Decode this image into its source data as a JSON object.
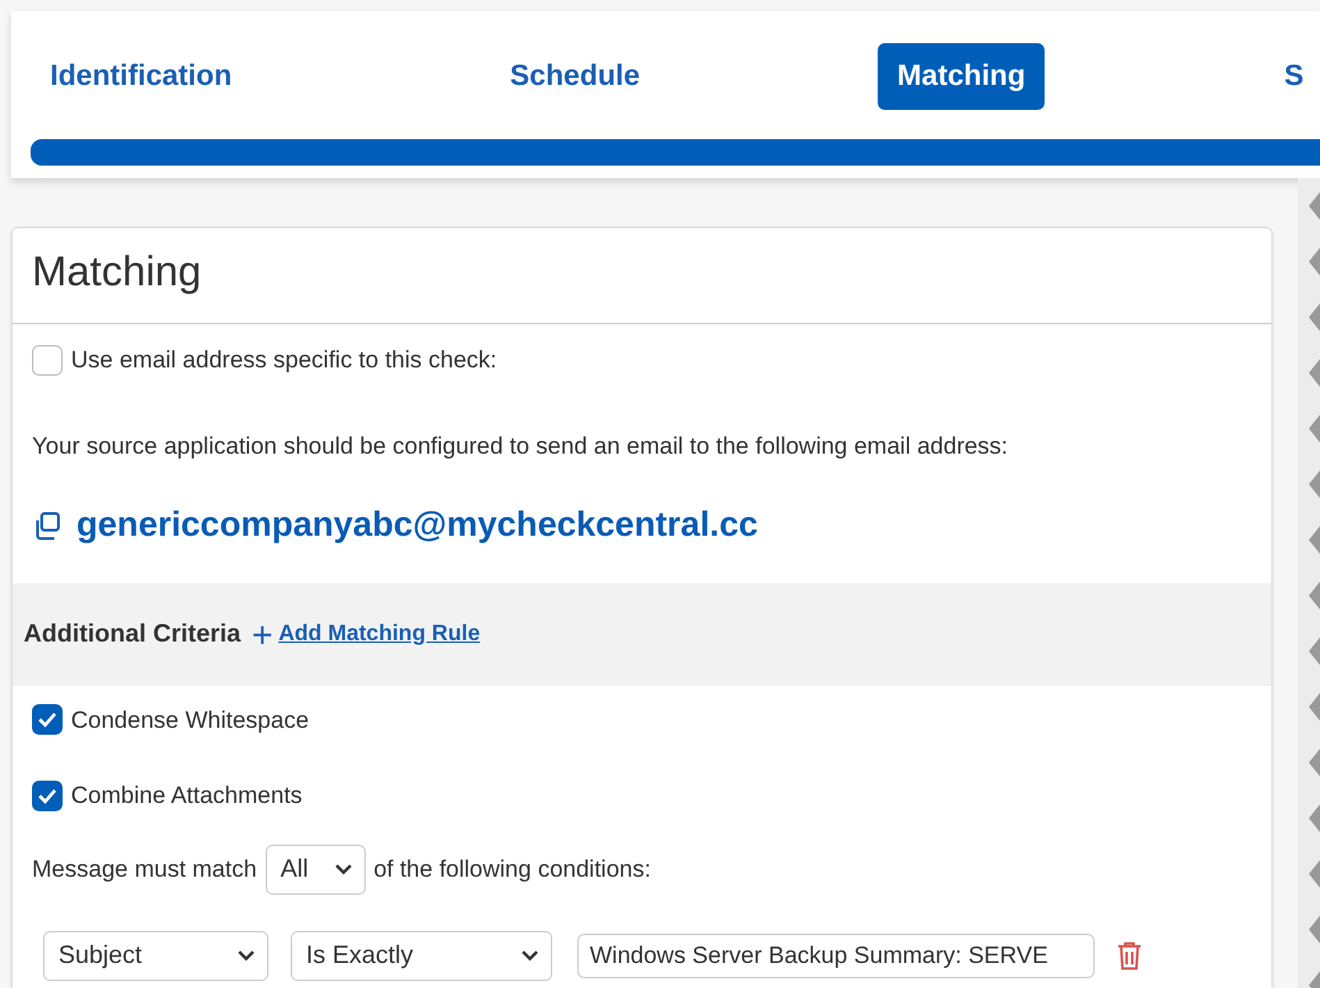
{
  "steps": [
    {
      "label": "Identification",
      "selected": false
    },
    {
      "label": "Schedule",
      "selected": false
    },
    {
      "label": "Matching",
      "selected": true
    },
    {
      "label": "S",
      "selected": false
    }
  ],
  "progress": {
    "level": 1
  },
  "card": {
    "title": "Matching",
    "specific_email": {
      "label": "Use email address specific to this check:",
      "checked": false
    },
    "instructions": "Your source application should be configured to send an email to the following email address:",
    "email": "genericcompanyabc@mycheckcentral.cc",
    "criteria": {
      "title": "Additional Criteria",
      "add_icon": "+",
      "add_link": "Add Matching Rule"
    },
    "options": [
      {
        "label": "Condense Whitespace",
        "checked": true
      },
      {
        "label": "Combine Attachments",
        "checked": true
      }
    ],
    "match": {
      "before": "Message must match",
      "value": "All",
      "after": "of the following conditions:"
    },
    "conditions": [
      {
        "field": "Subject",
        "operator": "Is Exactly",
        "value": "Windows Server Backup Summary: SERVE"
      }
    ]
  }
}
